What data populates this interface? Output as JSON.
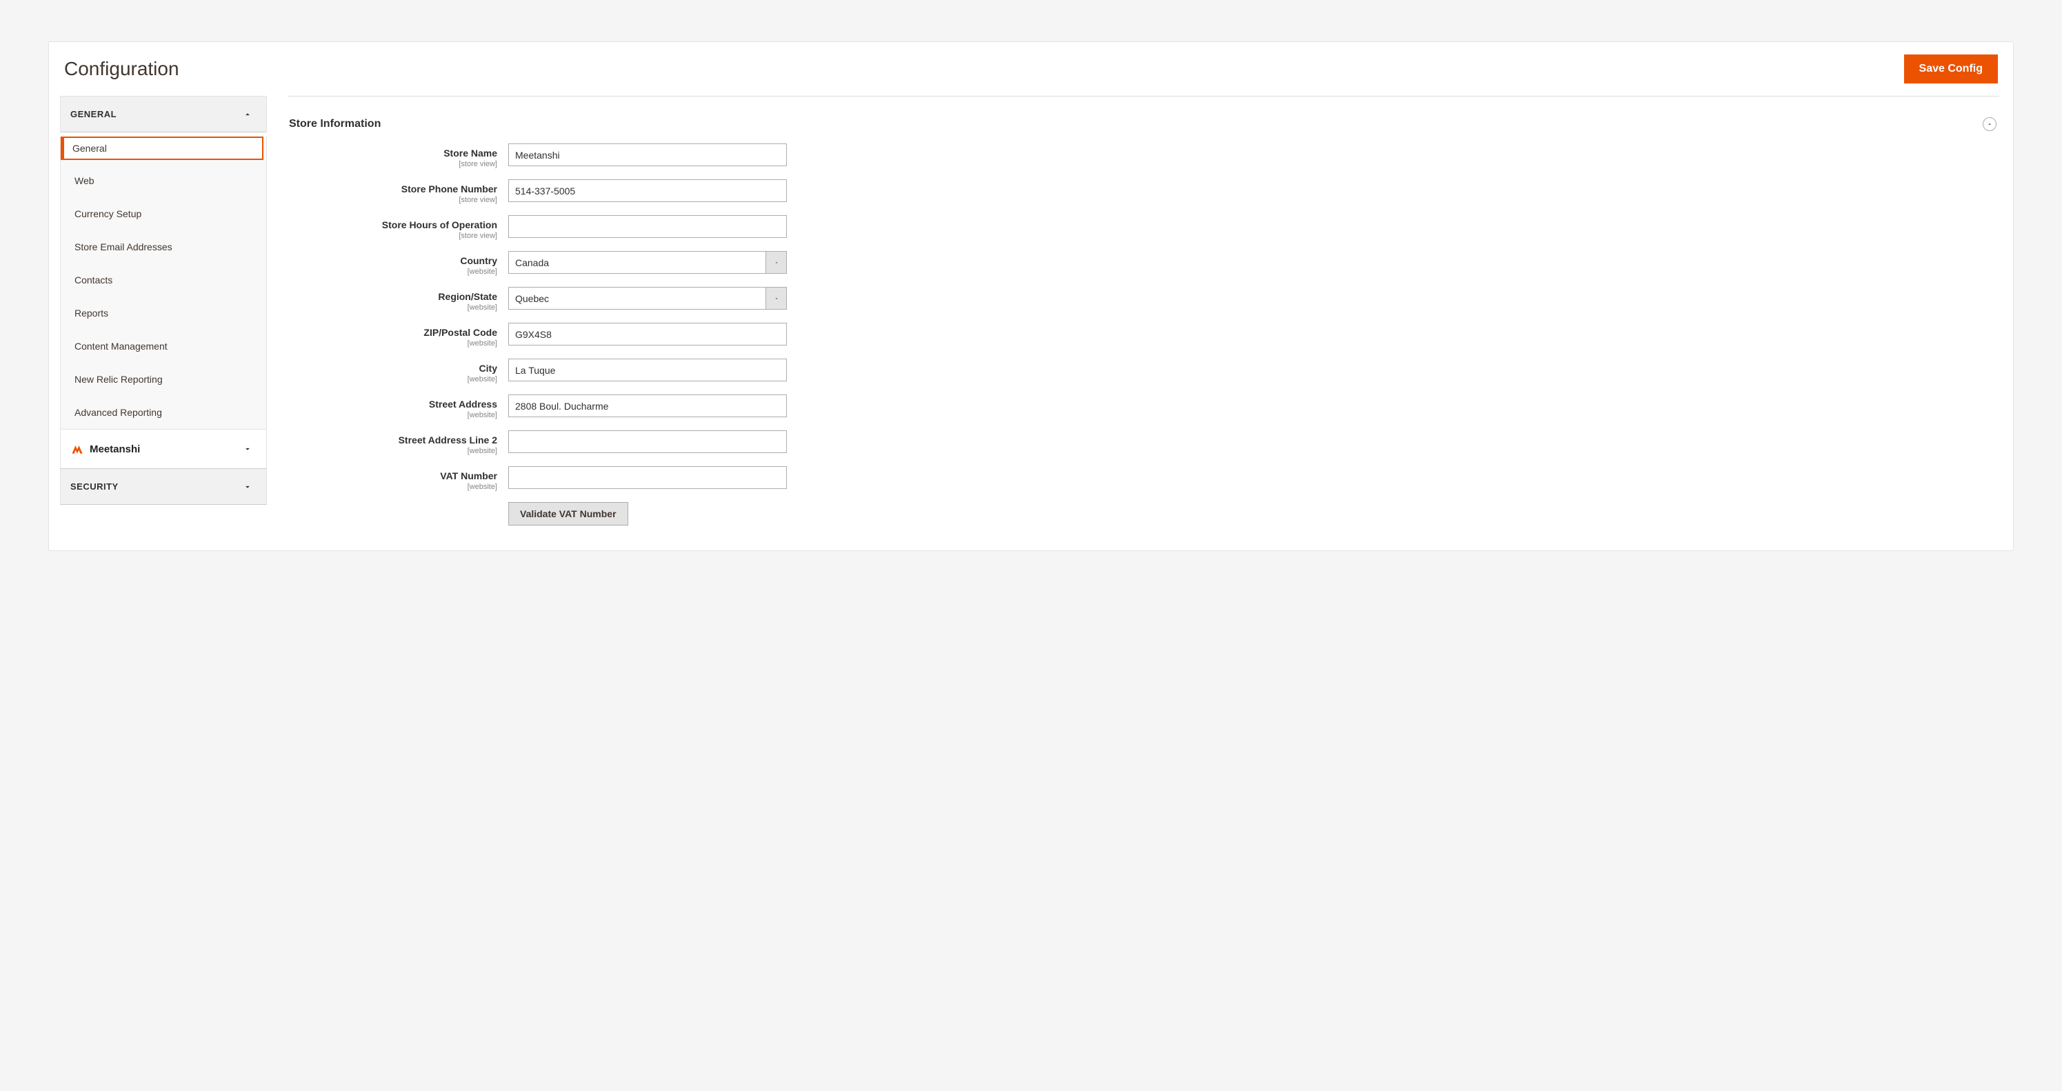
{
  "header": {
    "title": "Configuration",
    "save_label": "Save Config"
  },
  "sidebar": {
    "groups": [
      {
        "label": "GENERAL",
        "expanded": true,
        "items": [
          {
            "label": "General",
            "active": true
          },
          {
            "label": "Web"
          },
          {
            "label": "Currency Setup"
          },
          {
            "label": "Store Email Addresses"
          },
          {
            "label": "Contacts"
          },
          {
            "label": "Reports"
          },
          {
            "label": "Content Management"
          },
          {
            "label": "New Relic Reporting"
          },
          {
            "label": "Advanced Reporting"
          }
        ]
      },
      {
        "label": "Meetanshi",
        "brand": true,
        "expanded": false
      },
      {
        "label": "SECURITY",
        "expanded": false
      }
    ]
  },
  "section": {
    "title": "Store Information",
    "fields": {
      "store_name": {
        "label": "Store Name",
        "scope": "[store view]",
        "value": "Meetanshi"
      },
      "phone": {
        "label": "Store Phone Number",
        "scope": "[store view]",
        "value": "514-337-5005"
      },
      "hours": {
        "label": "Store Hours of Operation",
        "scope": "[store view]",
        "value": ""
      },
      "country": {
        "label": "Country",
        "scope": "[website]",
        "value": "Canada"
      },
      "region": {
        "label": "Region/State",
        "scope": "[website]",
        "value": "Quebec"
      },
      "zip": {
        "label": "ZIP/Postal Code",
        "scope": "[website]",
        "value": "G9X4S8"
      },
      "city": {
        "label": "City",
        "scope": "[website]",
        "value": "La Tuque"
      },
      "street1": {
        "label": "Street Address",
        "scope": "[website]",
        "value": "2808 Boul. Ducharme"
      },
      "street2": {
        "label": "Street Address Line 2",
        "scope": "[website]",
        "value": ""
      },
      "vat": {
        "label": "VAT Number",
        "scope": "[website]",
        "value": ""
      }
    },
    "validate_label": "Validate VAT Number"
  }
}
